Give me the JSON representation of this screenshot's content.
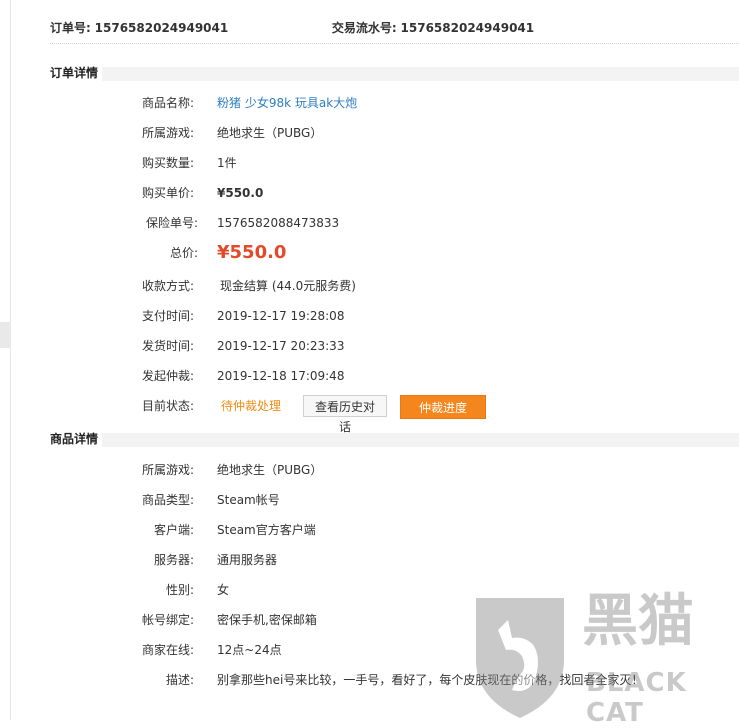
{
  "header": {
    "order_no_label": "订单号:",
    "order_no": "1576582024949041",
    "txn_no_label": "交易流水号:",
    "txn_no": "1576582024949041"
  },
  "order_details": {
    "title": "订单详情",
    "product_name_label": "商品名称:",
    "product_name": "粉猪 少女98k 玩具ak大炮",
    "game_label": "所属游戏:",
    "game": "绝地求生（PUBG）",
    "qty_label": "购买数量:",
    "qty": "1件",
    "unit_price_label": "购买单价:",
    "unit_price": "¥550.0",
    "insurance_label": "保险单号:",
    "insurance_no": "1576582088473833",
    "total_label": "总价:",
    "total": "¥550.0",
    "payment_method_label": "收款方式:",
    "payment_method": "现金结算 (44.0元服务费)",
    "pay_time_label": "支付时间:",
    "pay_time": "2019-12-17 19:28:08",
    "ship_time_label": "发货时间:",
    "ship_time": "2019-12-17 20:23:33",
    "arbitration_time_label": "发起仲裁:",
    "arbitration_time": "2019-12-18 17:09:48",
    "status_label": "目前状态:",
    "status": "待仲裁处理",
    "view_history_button": "查看历史对话",
    "arbitration_progress_button": "仲裁进度"
  },
  "product_details": {
    "title": "商品详情",
    "game_label": "所属游戏:",
    "game": "绝地求生（PUBG）",
    "type_label": "商品类型:",
    "type": "Steam帐号",
    "client_label": "客户端:",
    "client": "Steam官方客户端",
    "server_label": "服务器:",
    "server": "通用服务器",
    "gender_label": "性别:",
    "gender": "女",
    "binding_label": "帐号绑定:",
    "binding": "密保手机,密保邮箱",
    "online_label": "商家在线:",
    "online": "12点~24点",
    "desc_label": "描述:",
    "desc": "别拿那些hei号来比较，一手号，看好了，每个皮肤现在的价格，找回者全家灭！"
  },
  "watermark": {
    "cn": "黑猫",
    "en": "BLACK CAT"
  },
  "colors": {
    "link": "#2f7fc2",
    "price": "#e24a2a",
    "status": "#ef8b12",
    "primary_button": "#f5861e"
  }
}
